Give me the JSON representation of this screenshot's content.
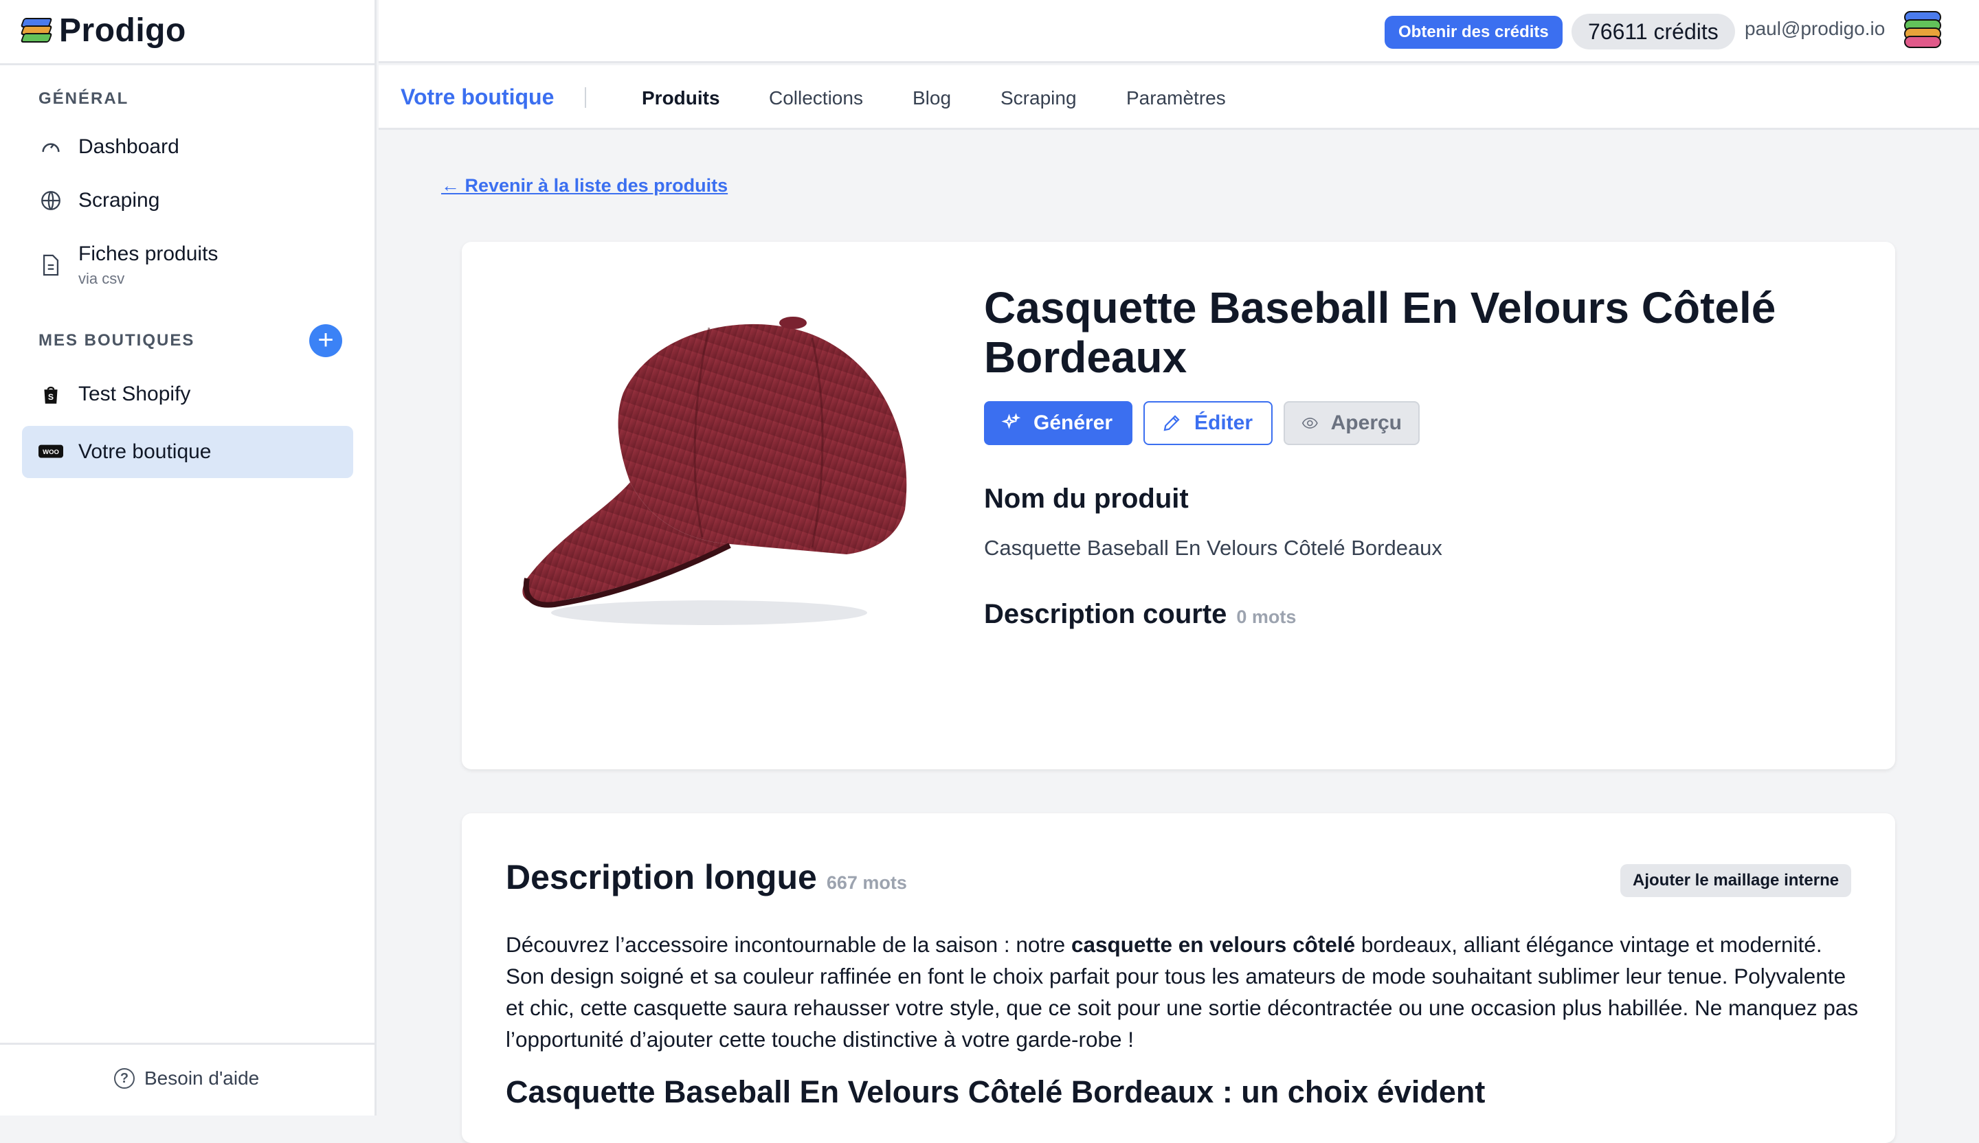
{
  "app": {
    "name": "Prodigo"
  },
  "sidebar": {
    "section_general": "GÉNÉRAL",
    "items": [
      {
        "label": "Dashboard",
        "icon": "gauge-icon"
      },
      {
        "label": "Scraping",
        "icon": "globe-icon"
      },
      {
        "label": "Fiches produits",
        "sub": "via csv",
        "icon": "file-icon"
      }
    ],
    "section_shops": "MES BOUTIQUES",
    "add_shop_label": "+",
    "shops": [
      {
        "label": "Test Shopify",
        "icon": "shopify-icon"
      },
      {
        "label": "Votre boutique",
        "icon": "woo-icon",
        "active": true
      }
    ],
    "help_label": "Besoin d'aide"
  },
  "topbar": {
    "get_credits": "Obtenir des crédits",
    "credits": "76611 crédits",
    "email": "paul@prodigo.io"
  },
  "subnav": {
    "store": "Votre boutique",
    "tabs": [
      "Produits",
      "Collections",
      "Blog",
      "Scraping",
      "Paramètres"
    ],
    "active_tab": "Produits"
  },
  "main": {
    "back_link": "← Revenir à la liste des produits",
    "product": {
      "title": "Casquette Baseball En Velours Côtelé Bordeaux",
      "btn_generate": "Générer",
      "btn_edit": "Éditer",
      "btn_preview": "Aperçu",
      "name_heading": "Nom du produit",
      "name_value": "Casquette Baseball En Velours Côtelé Bordeaux",
      "short_desc_heading": "Description courte",
      "short_desc_count": "0 mots"
    },
    "long_desc": {
      "heading": "Description longue",
      "count": "667 mots",
      "mesh_button": "Ajouter le maillage interne",
      "p_before": "Découvrez l’accessoire incontournable de la saison : notre ",
      "p_bold": "casquette en velours côtelé",
      "p_after": " bordeaux, alliant élégance vintage et modernité. Son design soigné et sa couleur raffinée en font le choix parfait pour tous les amateurs de mode souhaitant sublimer leur tenue. Polyvalente et chic, cette casquette saura rehausser votre style, que ce soit pour une sortie décontractée ou une occasion plus habillée. Ne manquez pas l’opportunité d’ajouter cette touche distinctive à votre garde-robe !",
      "subheading": "Casquette Baseball En Velours Côtelé Bordeaux : un choix évident"
    }
  },
  "colors": {
    "accent": "#3b6ff0",
    "active_bg": "#dbe7f8",
    "cap": "#8e2a35"
  }
}
